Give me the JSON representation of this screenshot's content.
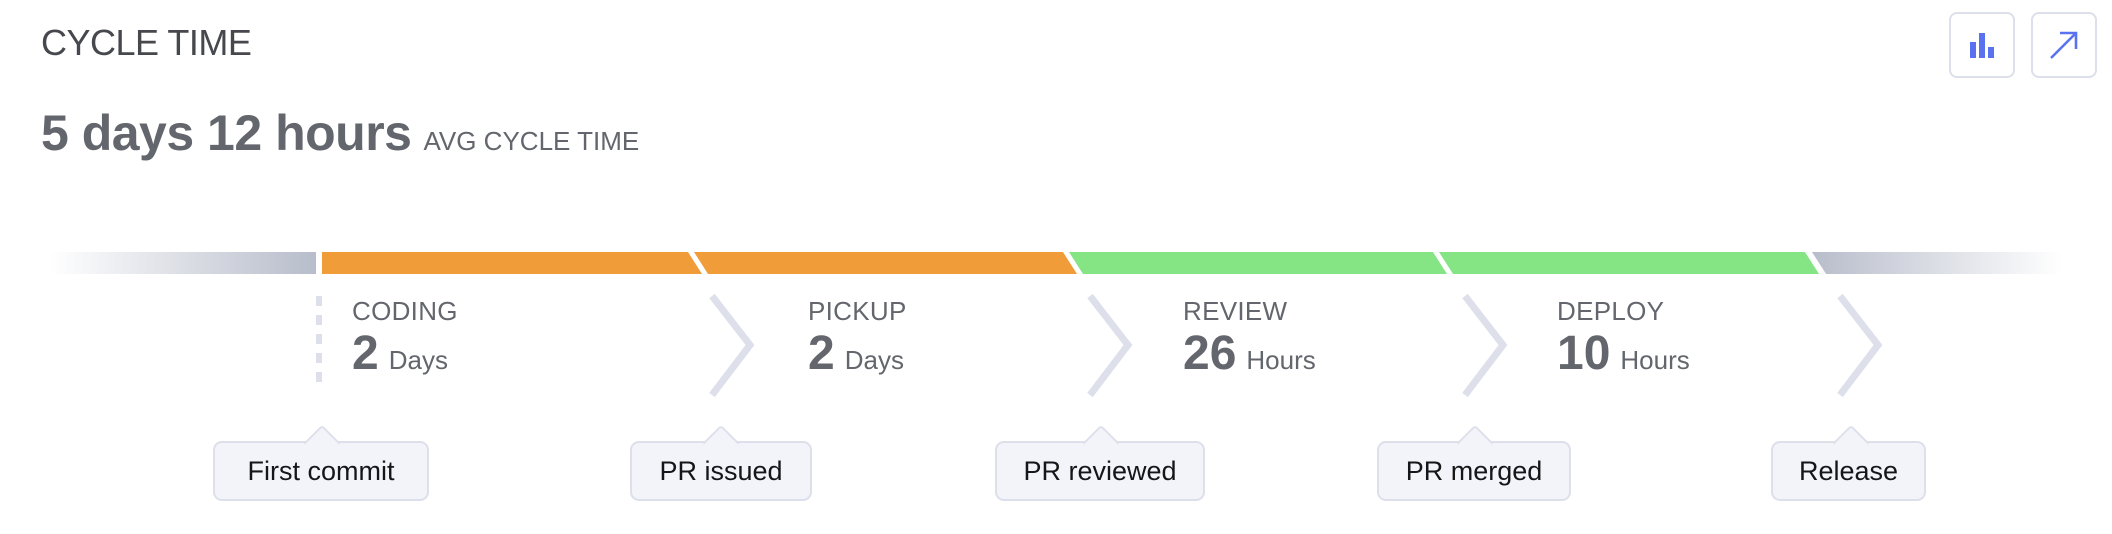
{
  "header": {
    "title": "CYCLE TIME",
    "avg_value": "5 days 12 hours",
    "avg_label": "AVG CYCLE TIME"
  },
  "toolbar": {
    "chart_button_icon": "bar-chart-icon",
    "expand_button_icon": "arrow-up-right-icon",
    "accent_color": "#5b72f0"
  },
  "stages": [
    {
      "name": "CODING",
      "value": "2",
      "unit": "Days",
      "color": "#f09c38"
    },
    {
      "name": "PICKUP",
      "value": "2",
      "unit": "Days",
      "color": "#f09c38"
    },
    {
      "name": "REVIEW",
      "value": "26",
      "unit": "Hours",
      "color": "#85e585"
    },
    {
      "name": "DEPLOY",
      "value": "10",
      "unit": "Hours",
      "color": "#85e585"
    }
  ],
  "milestones": [
    {
      "label": "First commit"
    },
    {
      "label": "PR issued"
    },
    {
      "label": "PR reviewed"
    },
    {
      "label": "PR merged"
    },
    {
      "label": "Release"
    }
  ],
  "colors": {
    "bar_fade": "#b8bdcb",
    "chevron": "#dde0ea"
  }
}
